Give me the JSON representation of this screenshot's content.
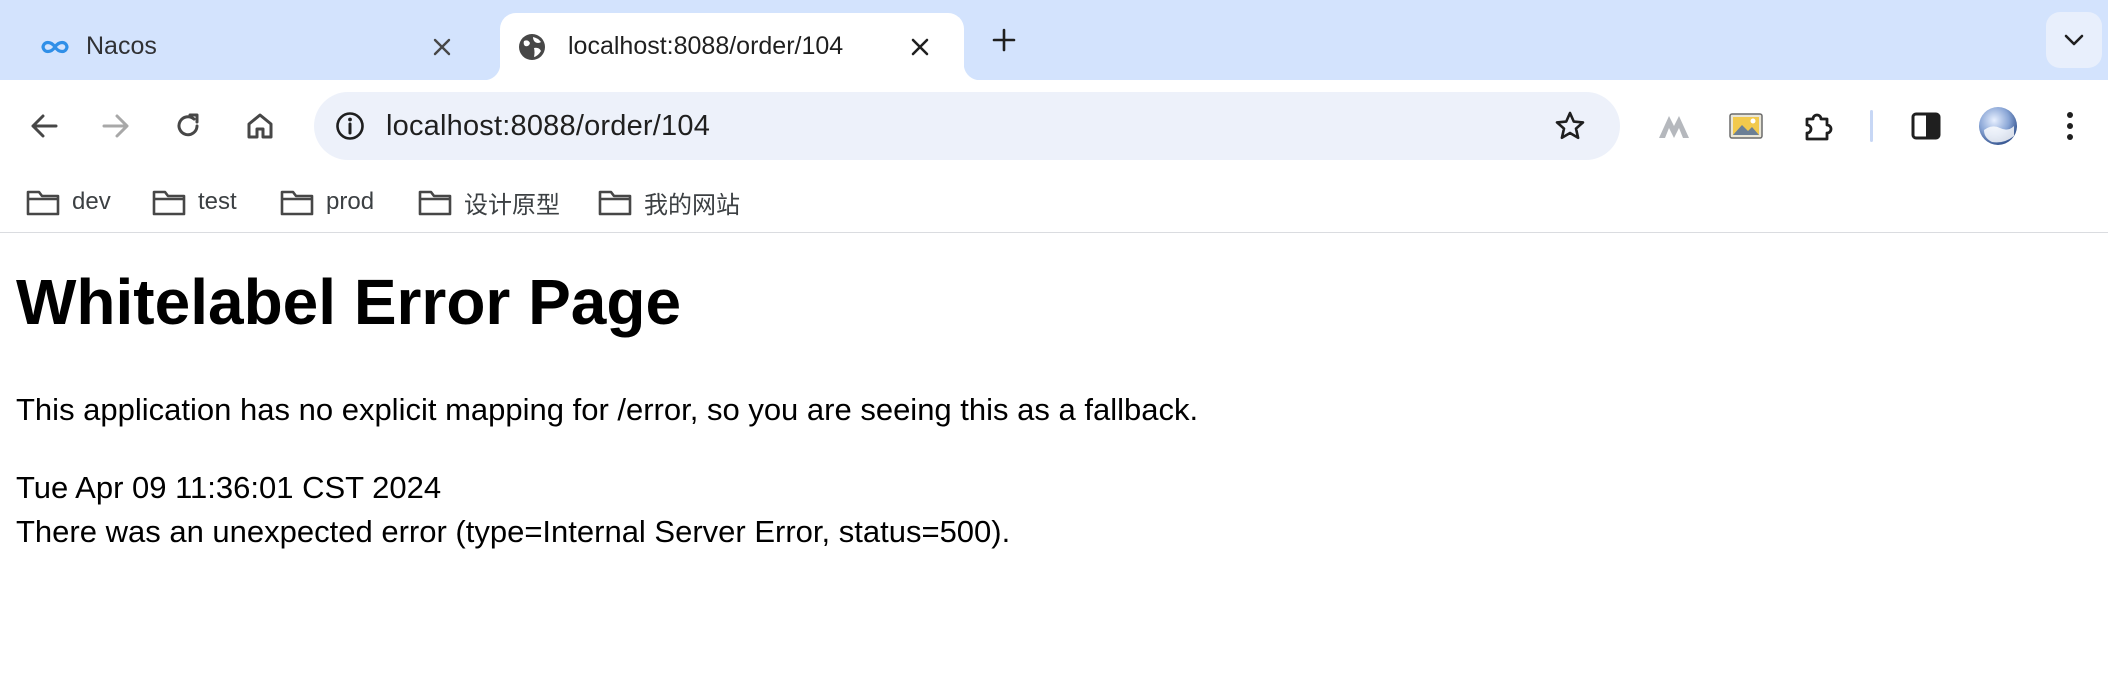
{
  "browser": {
    "tabs": [
      {
        "title": "Nacos",
        "icon": "nacos-logo-icon",
        "active": false
      },
      {
        "title": "localhost:8088/order/104",
        "icon": "globe-icon",
        "active": true
      }
    ],
    "address_bar": {
      "url": "localhost:8088/order/104"
    },
    "bookmarks": [
      {
        "label": "dev"
      },
      {
        "label": "test"
      },
      {
        "label": "prod"
      },
      {
        "label": "设计原型"
      },
      {
        "label": "我的网站"
      }
    ]
  },
  "page": {
    "heading": "Whitelabel Error Page",
    "description": "This application has no explicit mapping for /error, so you are seeing this as a fallback.",
    "timestamp": "Tue Apr 09 11:36:01 CST 2024",
    "error_message": "There was an unexpected error (type=Internal Server Error, status=500)."
  },
  "colors": {
    "tabstrip_bg": "#d3e3fd",
    "omnibox_bg": "#edf1fa",
    "nacos_accent": "#2f8fe8"
  }
}
